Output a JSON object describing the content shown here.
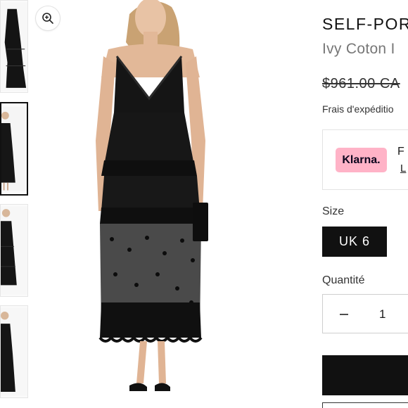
{
  "product": {
    "brand": "SELF-POR",
    "name": "Ivy Coton I",
    "price": "$961.00 CA",
    "shipping": "Frais d'expéditio"
  },
  "payment": {
    "provider": "Klarna.",
    "text": "F",
    "link": "L"
  },
  "size": {
    "label": "Size",
    "selected": "UK 6"
  },
  "quantity": {
    "label": "Quantité",
    "value": "1"
  },
  "colors": {
    "accent": "#111111",
    "klarna": "#ffb3c7"
  },
  "icons": {
    "zoom": "zoom-in-icon",
    "minus": "minus-icon"
  }
}
